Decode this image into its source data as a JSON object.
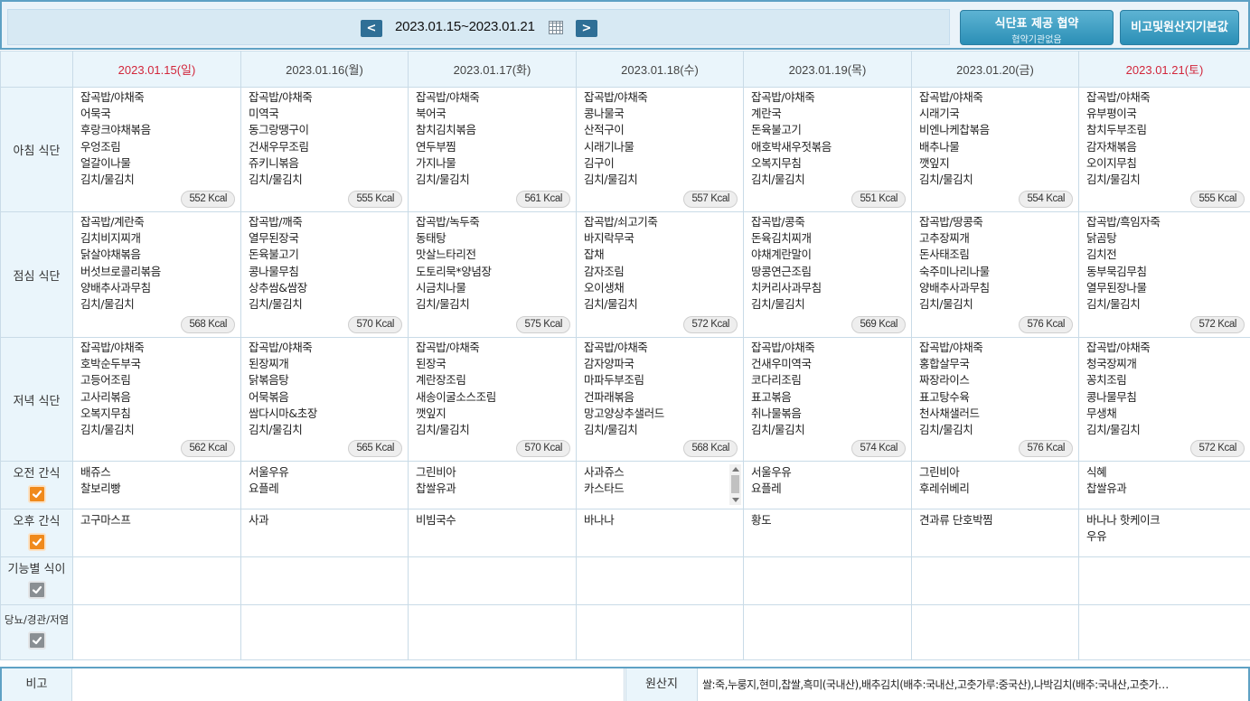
{
  "header": {
    "date_range": "2023.01.15~2023.01.21",
    "prev_label": "<",
    "next_label": ">",
    "menu_provide_button": {
      "title": "식단표 제공 협약",
      "subtitle": "협약기관없음"
    },
    "defaults_button": "비고및원산지기본값"
  },
  "days": [
    {
      "date": "2023.01.15(일)",
      "color": "#d2263b"
    },
    {
      "date": "2023.01.16(월)",
      "color": "#444444"
    },
    {
      "date": "2023.01.17(화)",
      "color": "#444444"
    },
    {
      "date": "2023.01.18(수)",
      "color": "#444444"
    },
    {
      "date": "2023.01.19(목)",
      "color": "#444444"
    },
    {
      "date": "2023.01.20(금)",
      "color": "#444444"
    },
    {
      "date": "2023.01.21(토)",
      "color": "#d2263b"
    }
  ],
  "meals": [
    {
      "label": "아침 식단",
      "cells": [
        {
          "items": [
            "잡곡밥/야채죽",
            "어묵국",
            "후랑크야채볶음",
            "우엉조림",
            "얼갈이나물",
            "김치/물김치"
          ],
          "kcal": "552 Kcal"
        },
        {
          "items": [
            "잡곡밥/야채죽",
            "미역국",
            "동그랑땡구이",
            "건새우무조림",
            "쥬키니볶음",
            "김치/물김치"
          ],
          "kcal": "555 Kcal"
        },
        {
          "items": [
            "잡곡밥/야채죽",
            "북어국",
            "참치김치볶음",
            "연두부찜",
            "가지나물",
            "김치/물김치"
          ],
          "kcal": "561 Kcal"
        },
        {
          "items": [
            "잡곡밥/야채죽",
            "콩나물국",
            "산적구이",
            "시래기나물",
            "김구이",
            "김치/물김치"
          ],
          "kcal": "557 Kcal"
        },
        {
          "items": [
            "잡곡밥/야채죽",
            "계란국",
            "돈육불고기",
            "애호박새우젓볶음",
            "오복지무침",
            "김치/물김치"
          ],
          "kcal": "551 Kcal"
        },
        {
          "items": [
            "잡곡밥/야채죽",
            "시래기국",
            "비엔나케찹볶음",
            "배추나물",
            "깻잎지",
            "김치/물김치"
          ],
          "kcal": "554 Kcal"
        },
        {
          "items": [
            "잡곡밥/야채죽",
            "유부평이국",
            "참치두부조림",
            "감자채볶음",
            "오이지무침",
            "김치/물김치"
          ],
          "kcal": "555 Kcal"
        }
      ]
    },
    {
      "label": "점심 식단",
      "cells": [
        {
          "items": [
            "잡곡밥/계란죽",
            "김치비지찌개",
            "닭살야채볶음",
            "버섯브로콜리볶음",
            "양배추사과무침",
            "김치/물김치"
          ],
          "kcal": "568 Kcal"
        },
        {
          "items": [
            "잡곡밥/깨죽",
            "열무된장국",
            "돈육불고기",
            "콩나물무침",
            "상추쌈&쌈장",
            "김치/물김치"
          ],
          "kcal": "570 Kcal"
        },
        {
          "items": [
            "잡곡밥/녹두죽",
            "동태탕",
            "맛살느타리전",
            "도토리묵*양념장",
            "시금치나물",
            "김치/물김치"
          ],
          "kcal": "575 Kcal"
        },
        {
          "items": [
            "잡곡밥/쇠고기죽",
            "바지락무국",
            "잡채",
            "감자조림",
            "오이생채",
            "김치/물김치"
          ],
          "kcal": "572 Kcal"
        },
        {
          "items": [
            "잡곡밥/콩죽",
            "돈육김치찌개",
            "야채계란말이",
            "땅콩연근조림",
            "치커리사과무침",
            "김치/물김치"
          ],
          "kcal": "569 Kcal"
        },
        {
          "items": [
            "잡곡밥/땅콩죽",
            "고추장찌개",
            "돈사태조림",
            "숙주미나리나물",
            "양배추사과무침",
            "김치/물김치"
          ],
          "kcal": "576 Kcal"
        },
        {
          "items": [
            "잡곡밥/흑임자죽",
            "닭곰탕",
            "김치전",
            "동부묵김무침",
            "열무된장나물",
            "김치/물김치"
          ],
          "kcal": "572 Kcal"
        }
      ]
    },
    {
      "label": "저녁 식단",
      "cells": [
        {
          "items": [
            "잡곡밥/야채죽",
            "호박순두부국",
            "고등어조림",
            "고사리볶음",
            "오복지무침",
            "김치/물김치"
          ],
          "kcal": "562 Kcal"
        },
        {
          "items": [
            "잡곡밥/야채죽",
            "된장찌개",
            "닭볶음탕",
            "어묵볶음",
            "쌈다시마&초장",
            "김치/물김치"
          ],
          "kcal": "565 Kcal"
        },
        {
          "items": [
            "잡곡밥/야채죽",
            "된장국",
            "계란장조림",
            "새송이굴소스조림",
            "깻잎지",
            "김치/물김치"
          ],
          "kcal": "570 Kcal"
        },
        {
          "items": [
            "잡곡밥/야채죽",
            "감자양파국",
            "마파두부조림",
            "건파래볶음",
            "망고양상추샐러드",
            "김치/물김치"
          ],
          "kcal": "568 Kcal"
        },
        {
          "items": [
            "잡곡밥/야채죽",
            "건새우미역국",
            "코다리조림",
            "표고볶음",
            "취나물볶음",
            "김치/물김치"
          ],
          "kcal": "574 Kcal"
        },
        {
          "items": [
            "잡곡밥/야채죽",
            "홍합살무국",
            "짜장라이스",
            "표고탕수육",
            "천사채샐러드",
            "김치/물김치"
          ],
          "kcal": "576 Kcal"
        },
        {
          "items": [
            "잡곡밥/야채죽",
            "청국장찌개",
            "꽁치조림",
            "콩나물무침",
            "무생채",
            "김치/물김치"
          ],
          "kcal": "572 Kcal"
        }
      ]
    }
  ],
  "snacks": [
    {
      "label": "오전 간식",
      "check": "orange",
      "cells": [
        [
          "배쥬스",
          "찰보리빵"
        ],
        [
          "서울우유",
          "요플레"
        ],
        [
          "그린비아",
          "찹쌀유과"
        ],
        [
          "사과쥬스",
          "카스타드"
        ],
        [
          "서울우유",
          "요플레"
        ],
        [
          "그린비아",
          "후레쉬베리"
        ],
        [
          "식혜",
          "찹쌀유과"
        ]
      ]
    },
    {
      "label": "오후 간식",
      "check": "orange",
      "cells": [
        [
          "고구마스프"
        ],
        [
          "사과"
        ],
        [
          "비빔국수"
        ],
        [
          "바나나"
        ],
        [
          "황도"
        ],
        [
          "견과류 단호박찜"
        ],
        [
          "바나나 핫케이크",
          "우유"
        ]
      ]
    },
    {
      "label": "기능별 식이",
      "check": "gray",
      "cells": [
        [],
        [],
        [],
        [],
        [],
        [],
        []
      ]
    },
    {
      "label": "당뇨/경관/저염",
      "check": "gray",
      "cells": [
        [],
        [],
        [],
        [],
        [],
        [],
        []
      ]
    }
  ],
  "footer": {
    "remarks_label": "비고",
    "remarks_value": "",
    "origin_label": "원산지",
    "origin_value": "쌀:죽,누룽지,현미,찹쌀,흑미(국내산),배추김치(배추:국내산,고춧가루:중국산),나박김치(배추:국내산,고춧가…"
  }
}
